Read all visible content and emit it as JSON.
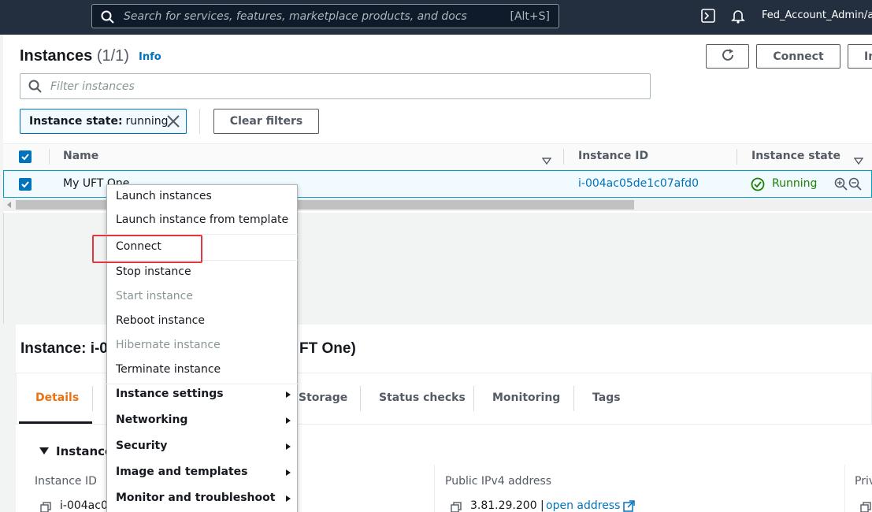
{
  "topbar": {
    "search_placeholder": "Search for services, features, marketplace products, and docs",
    "search_shortcut": "[Alt+S]",
    "account": "Fed_Account_Admin/av"
  },
  "header": {
    "title": "Instances",
    "count": "(1/1)",
    "info": "Info",
    "connect_label": "Connect",
    "more_label": "In"
  },
  "filter": {
    "placeholder": "Filter instances",
    "token_key": "Instance state:",
    "token_value": "running",
    "clear_label": "Clear filters"
  },
  "table": {
    "columns": [
      "Name",
      "Instance ID",
      "Instance state"
    ],
    "row": {
      "name": "My UFT One",
      "instance_id": "i-004ac05de1c07afd0",
      "state": "Running"
    }
  },
  "details": {
    "title_start": "Instance: i-0",
    "title_end": "FT One)",
    "tabs": [
      "Details",
      "Storage",
      "Status checks",
      "Monitoring",
      "Tags"
    ],
    "section": "Instance",
    "fields": {
      "instance_id_label": "Instance ID",
      "instance_id_value": "i-004ac0",
      "ipv4_label": "Public IPv4 address",
      "ipv4_value": "3.81.29.200 |",
      "ipv4_link": "open address",
      "private_label": "Priv"
    },
    "split_handle": "="
  },
  "context_menu": {
    "items": [
      {
        "label": "Launch instances"
      },
      {
        "label": "Launch instance from template"
      },
      {
        "label": "Connect"
      },
      {
        "label": "Stop instance"
      },
      {
        "label": "Start instance",
        "disabled": true
      },
      {
        "label": "Reboot instance"
      },
      {
        "label": "Hibernate instance",
        "disabled": true
      },
      {
        "label": "Terminate instance"
      },
      {
        "label": "Instance settings",
        "submenu": true
      },
      {
        "label": "Networking",
        "submenu": true
      },
      {
        "label": "Security",
        "submenu": true
      },
      {
        "label": "Image and templates",
        "submenu": true
      },
      {
        "label": "Monitor and troubleshoot",
        "submenu": true
      }
    ]
  },
  "colors": {
    "nav_bg": "#232f3e",
    "link": "#0073bb",
    "running": "#1d8102",
    "active_tab": "#ec7211",
    "highlight_box": "#e0383e"
  },
  "icons": [
    "search-icon",
    "cloudshell-icon",
    "bell-icon",
    "refresh-icon",
    "filter-search-icon",
    "close-icon",
    "sort-down-icon",
    "check-icon",
    "status-ok-icon",
    "zoom-in-icon",
    "zoom-out-icon",
    "copy-icon",
    "external-link-icon",
    "chevron-right-icon",
    "mouse-cursor-icon"
  ]
}
